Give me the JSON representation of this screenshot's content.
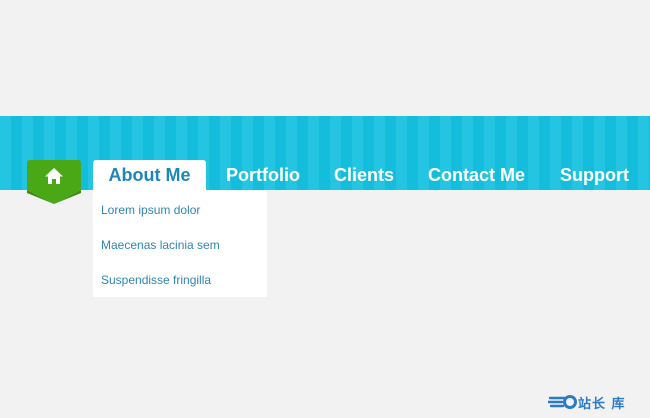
{
  "nav": {
    "home_icon": "home-icon",
    "items": [
      {
        "label": "About Me",
        "active": true
      },
      {
        "label": "Portfolio",
        "active": false
      },
      {
        "label": "Clients",
        "active": false
      },
      {
        "label": "Contact Me",
        "active": false
      },
      {
        "label": "Support",
        "active": false
      }
    ]
  },
  "dropdown": {
    "items": [
      {
        "label": "Lorem ipsum dolor"
      },
      {
        "label": "Maecenas lacinia sem"
      },
      {
        "label": "Suspendisse fringilla"
      }
    ]
  },
  "watermark": {
    "text": "站长 库"
  },
  "colors": {
    "background": "#f2f2f2",
    "nav_band": "#14c1e0",
    "home_tab": "#4aa816",
    "active_text": "#1f86ba",
    "dropdown_link": "#2f86b6",
    "nav_text": "#ffffff"
  }
}
